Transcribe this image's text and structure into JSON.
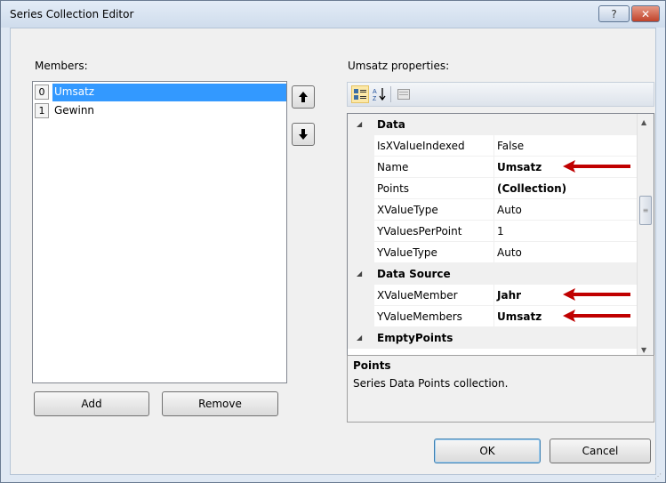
{
  "window": {
    "title": "Series Collection Editor",
    "help_glyph": "?",
    "close_glyph": "✕"
  },
  "members": {
    "label": "Members:",
    "items": [
      {
        "index": "0",
        "name": "Umsatz",
        "selected": true
      },
      {
        "index": "1",
        "name": "Gewinn",
        "selected": false
      }
    ],
    "move_up": "🡑",
    "move_down": "🡓"
  },
  "buttons": {
    "add": "Add",
    "remove": "Remove",
    "ok": "OK",
    "cancel": "Cancel"
  },
  "properties": {
    "label": "Umsatz properties:",
    "toolbar_icons": [
      "categorized-icon",
      "alphabetical-sort-icon",
      "property-pages-icon"
    ],
    "rows": [
      {
        "type": "category",
        "name": "Data"
      },
      {
        "type": "property",
        "name": "IsXValueIndexed",
        "value": "False",
        "bold": false
      },
      {
        "type": "property",
        "name": "Name",
        "value": "Umsatz",
        "bold": true,
        "arrow": true
      },
      {
        "type": "property",
        "name": "Points",
        "value": "(Collection)",
        "bold": true
      },
      {
        "type": "property",
        "name": "XValueType",
        "value": "Auto",
        "bold": false
      },
      {
        "type": "property",
        "name": "YValuesPerPoint",
        "value": "1",
        "bold": false
      },
      {
        "type": "property",
        "name": "YValueType",
        "value": "Auto",
        "bold": false
      },
      {
        "type": "category",
        "name": "Data Source"
      },
      {
        "type": "property",
        "name": "XValueMember",
        "value": "Jahr",
        "bold": true,
        "arrow": true
      },
      {
        "type": "property",
        "name": "YValueMembers",
        "value": "Umsatz",
        "bold": true,
        "arrow": true
      },
      {
        "type": "category",
        "name": "EmptyPoints"
      }
    ]
  },
  "description": {
    "title": "Points",
    "text": "Series Data Points collection."
  },
  "colors": {
    "selection": "#3399ff",
    "annotation_arrow": "#c00000"
  }
}
